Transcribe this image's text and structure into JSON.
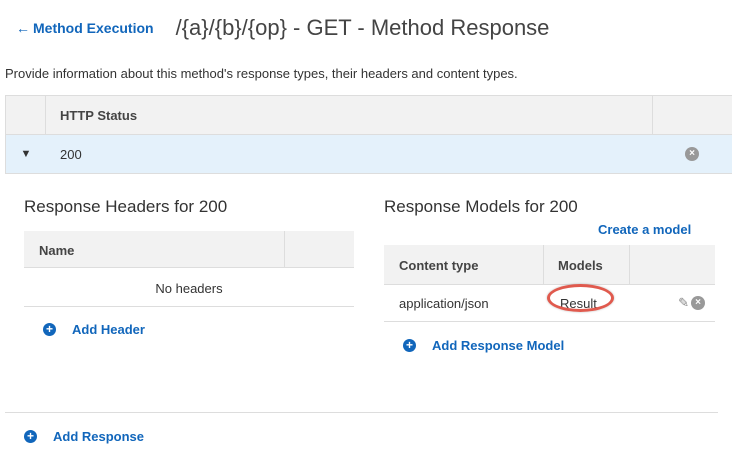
{
  "header": {
    "back_label": "Method Execution",
    "title": "/{a}/{b}/{op} - GET - Method Response"
  },
  "description": "Provide information about this method's response types, their headers and content types.",
  "status_table": {
    "column_header": "HTTP Status",
    "rows": [
      {
        "status": "200",
        "expanded": true
      }
    ]
  },
  "response_headers": {
    "title": "Response Headers for 200",
    "column_name": "Name",
    "empty_text": "No headers",
    "add_label": "Add Header"
  },
  "response_models": {
    "title": "Response Models for 200",
    "create_label": "Create a model",
    "columns": {
      "content_type": "Content type",
      "models": "Models"
    },
    "rows": [
      {
        "content_type": "application/json",
        "model": "Result"
      }
    ],
    "add_label": "Add Response Model"
  },
  "add_response_label": "Add Response",
  "colors": {
    "link": "#1166bb",
    "selected_row": "#e4f1fb",
    "header_bg": "#f2f2f2",
    "highlight": "#e05a4e"
  },
  "icons": {
    "back": "arrow-left-icon",
    "expand": "triangle-down-icon",
    "remove": "circle-x-icon",
    "add": "plus-circle-icon",
    "edit": "pencil-icon"
  }
}
